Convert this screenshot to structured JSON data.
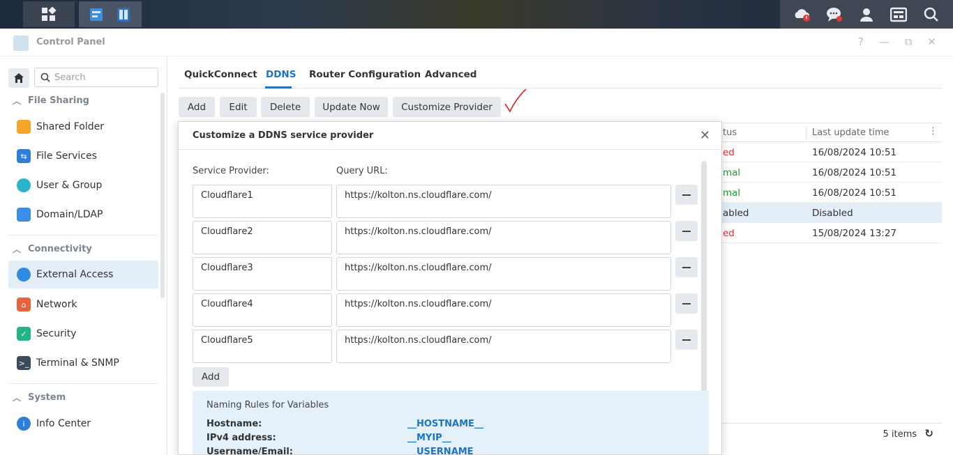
{
  "window": {
    "title": "Control Panel",
    "controls": [
      "?",
      "—",
      "⧉",
      "✕"
    ]
  },
  "taskbar": {
    "left_icons": [
      "main-menu-icon",
      "control-panel-app-icon",
      "storage-manager-app-icon"
    ],
    "right_icons": [
      "cloud-alert-icon",
      "chat-icon",
      "user-icon",
      "widgets-icon",
      "search-icon"
    ]
  },
  "sidebar": {
    "search_placeholder": "Search",
    "sections": [
      {
        "title": "File Sharing",
        "items": [
          "Shared Folder",
          "File Services",
          "User & Group",
          "Domain/LDAP"
        ]
      },
      {
        "title": "Connectivity",
        "items": [
          "External Access",
          "Network",
          "Security",
          "Terminal & SNMP"
        ]
      },
      {
        "title": "System",
        "items": [
          "Info Center"
        ]
      }
    ],
    "active_item": "External Access"
  },
  "tabs": [
    "QuickConnect",
    "DDNS",
    "Router Configuration",
    "Advanced"
  ],
  "active_tab": "DDNS",
  "toolbar": {
    "add": "Add",
    "edit": "Edit",
    "delete": "Delete",
    "update_now": "Update Now",
    "customize_provider": "Customize Provider"
  },
  "table": {
    "col_status": "tus",
    "col_last_update": "Last update time",
    "rows": [
      {
        "status": "ed",
        "status_color": "#d9312b",
        "last_update": "16/08/2024 10:51"
      },
      {
        "status": "mal",
        "status_color": "#1e9b33",
        "last_update": "16/08/2024 10:51"
      },
      {
        "status": "mal",
        "status_color": "#1e9b33",
        "last_update": "16/08/2024 10:51"
      },
      {
        "status": "abled",
        "status_color": "#333333",
        "last_update": "Disabled"
      },
      {
        "status": "ed",
        "status_color": "#d9312b",
        "last_update": "15/08/2024 13:27"
      }
    ],
    "count": "5 items"
  },
  "modal": {
    "title": "Customize a DDNS service provider",
    "provider_label": "Service Provider:",
    "url_label": "Query URL:",
    "providers": [
      {
        "name": "Cloudflare1",
        "url": "https://kolton.ns.cloudflare.com/"
      },
      {
        "name": "Cloudflare2",
        "url": "https://kolton.ns.cloudflare.com/"
      },
      {
        "name": "Cloudflare3",
        "url": "https://kolton.ns.cloudflare.com/"
      },
      {
        "name": "Cloudflare4",
        "url": "https://kolton.ns.cloudflare.com/"
      },
      {
        "name": "Cloudflare5",
        "url": "https://kolton.ns.cloudflare.com/"
      }
    ],
    "add_label": "Add",
    "rules_title": "Naming Rules for Variables",
    "rules": [
      {
        "label": "Hostname:",
        "var": "__HOSTNAME__"
      },
      {
        "label": "IPv4 address:",
        "var": "__MYIP__"
      },
      {
        "label": "Username/Email:",
        "var": "__USERNAME__"
      }
    ]
  },
  "colors": {
    "accent": "#1e73c4",
    "active_bg": "#e4eef8",
    "button_bg": "#e5e9ed"
  }
}
